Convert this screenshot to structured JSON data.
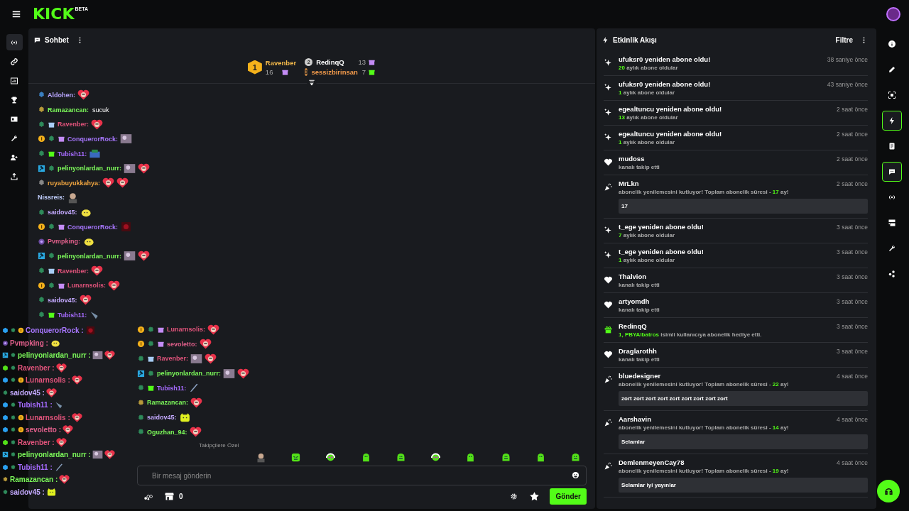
{
  "topbar": {
    "logo": "KICK",
    "logo_tag": "BETA"
  },
  "left_rail": [
    {
      "selected": true
    },
    {
      "selected": false
    },
    {
      "selected": false
    },
    {
      "selected": false
    },
    {
      "selected": false
    },
    {
      "selected": false
    },
    {
      "selected": false
    },
    {
      "selected": false
    }
  ],
  "chat": {
    "title": "Sohbet",
    "leaderboard": [
      {
        "rank": "1",
        "user": "Ravenber",
        "count": "16",
        "color": "#f2b84b"
      },
      {
        "rank": "2",
        "user": "RedinqQ",
        "count": "13",
        "color": "#ffffff"
      },
      {
        "rank": "3",
        "user": "sessizbirinsan",
        "count": "7",
        "color": "#f29a4b"
      }
    ],
    "messages": [
      {
        "badges": [
          {
            "kind": "sub"
          }
        ],
        "user": "Aldohen:",
        "color": "#b9a6ff",
        "emotes": [
          {
            "kind": "heart"
          }
        ]
      },
      {
        "badges": [
          {
            "kind": "og-gold"
          }
        ],
        "user": "Ramazancan:",
        "color": "#7cf95a",
        "text": "sucuk"
      },
      {
        "badges": [
          {
            "kind": "og"
          },
          {
            "kind": "gift-blue"
          }
        ],
        "user": "Ravenber:",
        "color": "#e2547c",
        "emotes": [
          {
            "kind": "heart"
          }
        ]
      },
      {
        "badges": [
          {
            "kind": "gold"
          },
          {
            "kind": "og"
          },
          {
            "kind": "gift"
          }
        ],
        "user": "ConquerorRock:",
        "color": "#a877ff",
        "emotes": [
          {
            "kind": "photo"
          }
        ]
      },
      {
        "badges": [
          {
            "kind": "og"
          },
          {
            "kind": "gift-green"
          }
        ],
        "user": "Tubish11:",
        "color": "#a66bff",
        "emotes": [
          {
            "kind": "pixel"
          }
        ]
      },
      {
        "badges": [
          {
            "kind": "mod"
          },
          {
            "kind": "og"
          }
        ],
        "user": "pelinyonlardan_nurr:",
        "color": "#7cf95a",
        "emotes": [
          {
            "kind": "photo"
          },
          {
            "kind": "heart"
          }
        ]
      },
      {
        "badges": [
          {
            "kind": "og-grey"
          }
        ],
        "user": "ruyabuyukkahya:",
        "color": "#f0a540",
        "emotes": [
          {
            "kind": "heart"
          },
          {
            "kind": "heart"
          }
        ]
      },
      {
        "user": "Nissreis:",
        "color": "#c3d0ff",
        "emotes": [
          {
            "kind": "man"
          }
        ]
      },
      {
        "badges": [
          {
            "kind": "og"
          }
        ],
        "user": "saidov45:",
        "color": "#c4aaff",
        "emotes": [
          {
            "kind": "blob"
          }
        ]
      },
      {
        "badges": [
          {
            "kind": "gold"
          },
          {
            "kind": "og"
          },
          {
            "kind": "gift"
          }
        ],
        "user": "ConquerorRock:",
        "color": "#a877ff",
        "emotes": [
          {
            "kind": "dark"
          }
        ]
      },
      {
        "badges": [
          {
            "kind": "purple"
          }
        ],
        "user": "Pvmpking:",
        "color": "#e2608c",
        "emotes": [
          {
            "kind": "blob"
          }
        ]
      },
      {
        "badges": [
          {
            "kind": "mod"
          },
          {
            "kind": "og"
          }
        ],
        "user": "pelinyonlardan_nurr:",
        "color": "#7cf95a",
        "emotes": [
          {
            "kind": "photo"
          },
          {
            "kind": "heart"
          }
        ]
      },
      {
        "badges": [
          {
            "kind": "og"
          },
          {
            "kind": "gift-blue"
          }
        ],
        "user": "Ravenber:",
        "color": "#e2547c",
        "emotes": [
          {
            "kind": "heart"
          }
        ]
      },
      {
        "badges": [
          {
            "kind": "gold"
          },
          {
            "kind": "og"
          },
          {
            "kind": "gift"
          }
        ],
        "user": "Lunarnsolis:",
        "color": "#e2547c",
        "emotes": [
          {
            "kind": "heart"
          }
        ]
      },
      {
        "badges": [
          {
            "kind": "og"
          }
        ],
        "user": "saidov45:",
        "color": "#c4aaff",
        "emotes": [
          {
            "kind": "heart"
          }
        ]
      },
      {
        "badges": [
          {
            "kind": "og"
          },
          {
            "kind": "gift-green"
          }
        ],
        "user": "Tubish11:",
        "color": "#a66bff",
        "emotes": [
          {
            "kind": "fish"
          }
        ]
      },
      {
        "badges": [
          {
            "kind": "gold"
          },
          {
            "kind": "og"
          },
          {
            "kind": "gift"
          }
        ],
        "user": "Lunarnsolis:",
        "color": "#e2547c",
        "emotes": [
          {
            "kind": "heart"
          }
        ]
      },
      {
        "badges": [
          {
            "kind": "gold"
          },
          {
            "kind": "og"
          },
          {
            "kind": "gift"
          }
        ],
        "user": "sevoletto:",
        "color": "#e2608c",
        "emotes": [
          {
            "kind": "heart"
          }
        ]
      },
      {
        "badges": [
          {
            "kind": "og"
          },
          {
            "kind": "gift-blue"
          }
        ],
        "user": "Ravenber:",
        "color": "#e2547c",
        "emotes": [
          {
            "kind": "photo"
          },
          {
            "kind": "heart"
          }
        ]
      },
      {
        "badges": [
          {
            "kind": "mod"
          },
          {
            "kind": "og"
          }
        ],
        "user": "pelinyonlardan_nurr:",
        "color": "#7cf95a",
        "emotes": [
          {
            "kind": "photo"
          },
          {
            "kind": "heart"
          }
        ]
      },
      {
        "badges": [
          {
            "kind": "og"
          },
          {
            "kind": "gift-green"
          }
        ],
        "user": "Tubish11:",
        "color": "#a66bff",
        "emotes": [
          {
            "kind": "brush"
          }
        ]
      },
      {
        "badges": [
          {
            "kind": "og-gold"
          }
        ],
        "user": "Ramazancan:",
        "color": "#7cf95a",
        "emotes": [
          {
            "kind": "heart"
          }
        ]
      },
      {
        "badges": [
          {
            "kind": "og"
          }
        ],
        "user": "saidov45:",
        "color": "#c4aaff",
        "emotes": [
          {
            "kind": "cat"
          }
        ]
      },
      {
        "badges": [
          {
            "kind": "og"
          }
        ],
        "user": "Oguzhan_94:",
        "color": "#7cf95a",
        "emotes": [
          {
            "kind": "heart"
          }
        ]
      }
    ],
    "followers_label": "Takipçilere Özel",
    "emote_strip": [
      {
        "kind": "man"
      },
      {
        "kind": "angry"
      },
      {
        "kind": "headphones"
      },
      {
        "kind": "ghost"
      },
      {
        "kind": "grin"
      },
      {
        "kind": "headphones"
      },
      {
        "kind": "ghost"
      },
      {
        "kind": "grin"
      },
      {
        "kind": "ghost"
      },
      {
        "kind": "grin"
      }
    ],
    "input": {
      "placeholder": "Bir mesaj gönderin"
    },
    "points": "0",
    "send": "Gönder"
  },
  "overlay_chat": [
    {
      "badges": [
        {
          "kind": "cube-blue"
        },
        {
          "kind": "og"
        },
        {
          "kind": "gold"
        }
      ],
      "user": "ConquerorRock :",
      "color": "#a877ff",
      "emotes": [
        {
          "kind": "dark"
        }
      ]
    },
    {
      "badges": [
        {
          "kind": "purple"
        }
      ],
      "user": "Pvmpking :",
      "color": "#e2608c",
      "emotes": [
        {
          "kind": "blob"
        }
      ]
    },
    {
      "badges": [
        {
          "kind": "mod"
        },
        {
          "kind": "og"
        }
      ],
      "user": "pelinyonlardan_nurr :",
      "color": "#7cf95a",
      "emotes": [
        {
          "kind": "photo"
        },
        {
          "kind": "heart"
        }
      ]
    },
    {
      "badges": [
        {
          "kind": "cube-green"
        },
        {
          "kind": "og"
        }
      ],
      "user": "Ravenber :",
      "color": "#e2547c",
      "emotes": [
        {
          "kind": "heart"
        }
      ]
    },
    {
      "badges": [
        {
          "kind": "cube-blue"
        },
        {
          "kind": "og"
        },
        {
          "kind": "gold"
        }
      ],
      "user": "Lunarnsolis :",
      "color": "#e2547c",
      "emotes": [
        {
          "kind": "heart"
        }
      ]
    },
    {
      "badges": [
        {
          "kind": "og"
        }
      ],
      "user": "saidov45 :",
      "color": "#c4aaff",
      "emotes": [
        {
          "kind": "heart"
        }
      ]
    },
    {
      "badges": [
        {
          "kind": "cube-blue"
        },
        {
          "kind": "og"
        }
      ],
      "user": "Tubish11 :",
      "color": "#a66bff",
      "emotes": [
        {
          "kind": "fish"
        }
      ]
    },
    {
      "badges": [
        {
          "kind": "cube-blue"
        },
        {
          "kind": "og"
        },
        {
          "kind": "gold"
        }
      ],
      "user": "Lunarnsolis :",
      "color": "#e2547c",
      "emotes": [
        {
          "kind": "heart"
        }
      ]
    },
    {
      "badges": [
        {
          "kind": "cube-blue"
        },
        {
          "kind": "og"
        },
        {
          "kind": "gold"
        }
      ],
      "user": "sevoletto :",
      "color": "#e2608c",
      "emotes": [
        {
          "kind": "heart"
        }
      ]
    },
    {
      "badges": [
        {
          "kind": "cube-green"
        },
        {
          "kind": "og"
        }
      ],
      "user": "Ravenber :",
      "color": "#e2547c",
      "emotes": [
        {
          "kind": "heart"
        }
      ]
    },
    {
      "badges": [
        {
          "kind": "mod"
        },
        {
          "kind": "og"
        }
      ],
      "user": "pelinyonlardan_nurr :",
      "color": "#7cf95a",
      "emotes": [
        {
          "kind": "photo"
        },
        {
          "kind": "heart"
        }
      ]
    },
    {
      "badges": [
        {
          "kind": "cube-blue"
        },
        {
          "kind": "og"
        }
      ],
      "user": "Tubish11 :",
      "color": "#a66bff",
      "emotes": [
        {
          "kind": "brush"
        }
      ]
    },
    {
      "badges": [
        {
          "kind": "og-gold"
        }
      ],
      "user": "Ramazancan :",
      "color": "#7cf95a",
      "emotes": [
        {
          "kind": "heart"
        }
      ]
    },
    {
      "badges": [
        {
          "kind": "og"
        }
      ],
      "user": "saidov45 :",
      "color": "#c4aaff",
      "emotes": [
        {
          "kind": "cat"
        }
      ]
    }
  ],
  "events": {
    "title": "Etkinlik Akışı",
    "filter": "Filtre",
    "items": [
      {
        "kind": "resub",
        "title": "ufuksr0 yeniden abone oldu!",
        "time": "38 saniye önce",
        "detail": [
          {
            "text": "20",
            "accent": true
          },
          {
            "text": " aylık abone oldular",
            "accent": false
          }
        ]
      },
      {
        "kind": "resub",
        "title": "ufuksr0 yeniden abone oldu!",
        "time": "43 saniye önce",
        "detail": [
          {
            "text": "1",
            "accent": true
          },
          {
            "text": " aylık abone oldular",
            "accent": false
          }
        ]
      },
      {
        "kind": "resub",
        "title": "egealtuncu yeniden abone oldu!",
        "time": "2 saat önce",
        "detail": [
          {
            "text": "13",
            "accent": true
          },
          {
            "text": " aylık abone oldular",
            "accent": false
          }
        ]
      },
      {
        "kind": "resub",
        "title": "egealtuncu yeniden abone oldu!",
        "time": "2 saat önce",
        "detail": [
          {
            "text": "1",
            "accent": true
          },
          {
            "text": " aylık abone oldular",
            "accent": false
          }
        ]
      },
      {
        "kind": "follow",
        "title": "mudoss",
        "time": "2 saat önce",
        "detail": [
          {
            "text": "kanalı takip etti",
            "accent": false
          }
        ]
      },
      {
        "kind": "celebrate",
        "title": "MrLkn",
        "time": "2 saat önce",
        "detail": [
          {
            "text": "abonelik yenilemesini kutluyor! Toplam abonelik süresi - ",
            "accent": false
          },
          {
            "text": "17",
            "accent": true
          },
          {
            "text": " ay!",
            "accent": false
          }
        ],
        "message": "17"
      },
      {
        "kind": "resub",
        "title": "t_ege yeniden abone oldu!",
        "time": "3 saat önce",
        "detail": [
          {
            "text": "7",
            "accent": true
          },
          {
            "text": " aylık abone oldular",
            "accent": false
          }
        ]
      },
      {
        "kind": "resub",
        "title": "t_ege yeniden abone oldu!",
        "time": "3 saat önce",
        "detail": [
          {
            "text": "1",
            "accent": true
          },
          {
            "text": " aylık abone oldular",
            "accent": false
          }
        ]
      },
      {
        "kind": "follow",
        "title": "Thalvion",
        "time": "3 saat önce",
        "detail": [
          {
            "text": "kanalı takip etti",
            "accent": false
          }
        ]
      },
      {
        "kind": "follow",
        "title": "artyomdh",
        "time": "3 saat önce",
        "detail": [
          {
            "text": "kanalı takip etti",
            "accent": false
          }
        ]
      },
      {
        "kind": "gift",
        "title": "RedinqQ",
        "time": "3 saat önce",
        "detail": [
          {
            "text": "1, PBYAlbatros",
            "accent": true
          },
          {
            "text": " isimli kullanıcıya abonelik hediye etti.",
            "accent": false
          }
        ]
      },
      {
        "kind": "follow",
        "title": "Draglarothh",
        "time": "3 saat önce",
        "detail": [
          {
            "text": "kanalı takip etti",
            "accent": false
          }
        ]
      },
      {
        "kind": "celebrate",
        "title": "bluedesigner",
        "time": "4 saat önce",
        "detail": [
          {
            "text": "abonelik yenilemesini kutluyor! Toplam abonelik süresi - ",
            "accent": false
          },
          {
            "text": "22",
            "accent": true
          },
          {
            "text": " ay!",
            "accent": false
          }
        ],
        "message": "zort zort zort zort zort zort zort zort zort"
      },
      {
        "kind": "celebrate",
        "title": "Aarshavin",
        "time": "4 saat önce",
        "detail": [
          {
            "text": "abonelik yenilemesini kutluyor! Toplam abonelik süresi - ",
            "accent": false
          },
          {
            "text": "14",
            "accent": true
          },
          {
            "text": " ay!",
            "accent": false
          }
        ],
        "message": "Selamlar"
      },
      {
        "kind": "celebrate",
        "title": "DemlenmeyenCay78",
        "time": "4 saat önce",
        "detail": [
          {
            "text": "abonelik yenilemesini kutluyor! Toplam abonelik süresi - ",
            "accent": false
          },
          {
            "text": "19",
            "accent": true
          },
          {
            "text": " ay!",
            "accent": false
          }
        ],
        "message": "Selamlar iyi yayınlar"
      }
    ]
  },
  "right_rail": [
    {
      "selected": false
    },
    {
      "selected": false
    },
    {
      "selected": false
    },
    {
      "selected": true
    },
    {
      "selected": false
    },
    {
      "selected": true
    },
    {
      "selected": false
    },
    {
      "selected": false
    },
    {
      "selected": false
    },
    {
      "selected": false
    }
  ]
}
